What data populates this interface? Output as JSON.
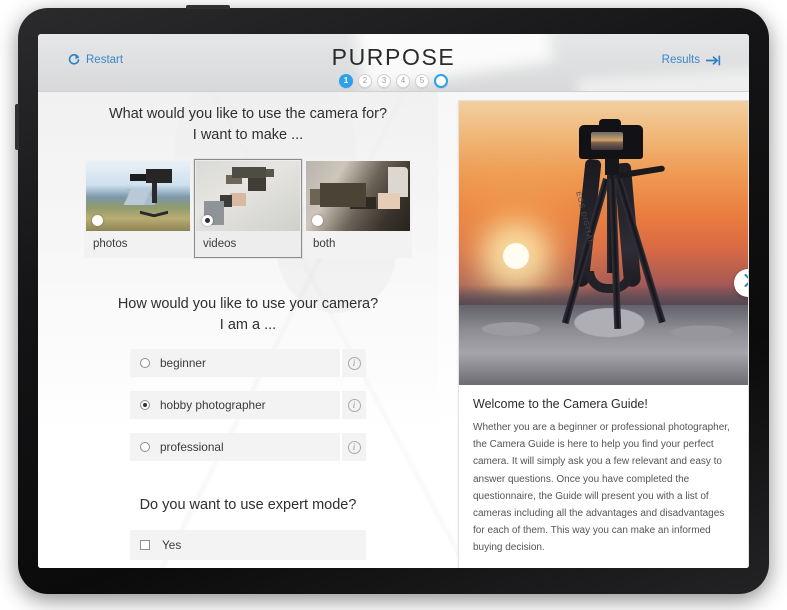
{
  "header": {
    "title": "PURPOSE",
    "restart_label": "Restart",
    "restart_icon": "refresh-icon",
    "results_label": "Results",
    "results_icon": "arrow-to-end-icon",
    "steps": [
      {
        "label": "1",
        "state": "active"
      },
      {
        "label": "2",
        "state": "inactive"
      },
      {
        "label": "3",
        "state": "inactive"
      },
      {
        "label": "4",
        "state": "inactive"
      },
      {
        "label": "5",
        "state": "inactive"
      },
      {
        "label": "",
        "state": "ring"
      }
    ],
    "accent_color": "#2e9fe8",
    "link_color": "#3a87c8",
    "bar_color": "#dedfe0"
  },
  "questions": [
    {
      "title_line1": "What would you like to use the camera for?",
      "title_line2": "I want to make ...",
      "type": "image-choice",
      "options": [
        {
          "label": "photos",
          "art": "art-photos",
          "selected": false
        },
        {
          "label": "videos",
          "art": "art-videos",
          "selected": true
        },
        {
          "label": "both",
          "art": "art-both",
          "selected": false
        }
      ]
    },
    {
      "title_line1": "How would you like to use your camera?",
      "title_line2": "I am a ...",
      "type": "radio-list",
      "options": [
        {
          "label": "beginner",
          "selected": false,
          "info_icon": "info-icon"
        },
        {
          "label": "hobby photographer",
          "selected": true,
          "info_icon": "info-icon"
        },
        {
          "label": "professional",
          "selected": false,
          "info_icon": "info-icon"
        }
      ]
    },
    {
      "title_line1": "Do you want to use expert mode?",
      "title_line2": "",
      "type": "checkbox",
      "options": [
        {
          "label": "Yes",
          "checked": false
        }
      ]
    }
  ],
  "info_panel": {
    "image_alt": "camera-on-tripod-at-sunset",
    "strap_text": "EOS DIGITAL",
    "next_icon": "chevron-right-icon",
    "heading": "Welcome to the Camera Guide!",
    "body": "Whether you are a beginner or professional photographer, the Camera Guide is here to help you find your perfect camera. It will simply ask you a few relevant and easy to answer questions. Once you have completed the questionnaire, the Guide will present you with a list of cameras including all the advantages and disadvantages for each of them. This way you can make an informed buying decision."
  }
}
